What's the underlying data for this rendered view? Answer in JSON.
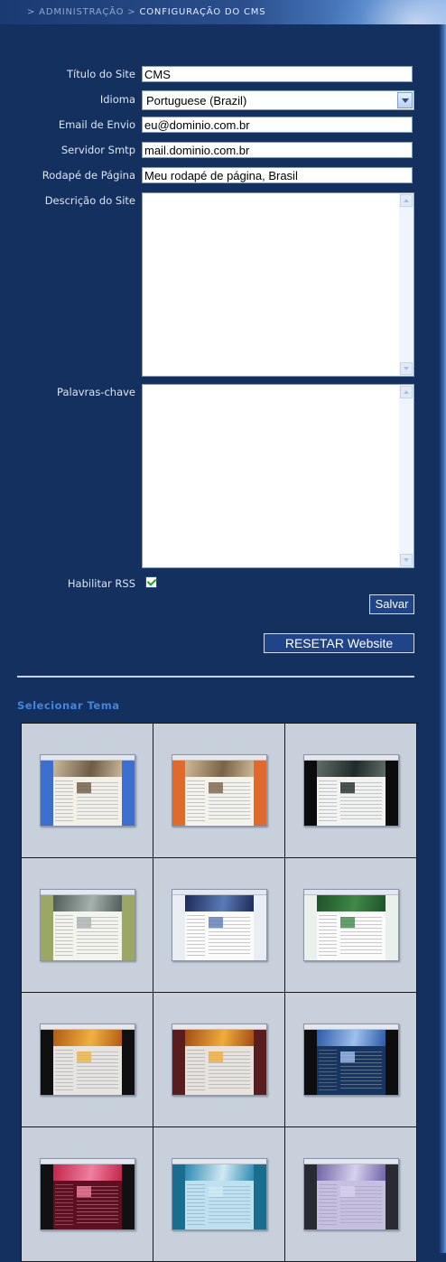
{
  "breadcrumb": {
    "sep": ">",
    "parent": "ADMINISTRAÇÃO",
    "current": "CONFIGURAÇÃO DO CMS"
  },
  "form": {
    "site_title": {
      "label": "Título do Site",
      "value": "CMS"
    },
    "language": {
      "label": "Idioma",
      "value": "Portuguese (Brazil)"
    },
    "email": {
      "label": "Email de Envio",
      "value": "eu@dominio.com.br"
    },
    "smtp": {
      "label": "Servidor Smtp",
      "value": "mail.dominio.com.br"
    },
    "footer": {
      "label": "Rodapé de Página",
      "value": "Meu rodapé de página, Brasil"
    },
    "description": {
      "label": "Descrição do Site",
      "value": ""
    },
    "keywords": {
      "label": "Palavras-chave",
      "value": ""
    },
    "rss": {
      "label": "Habilitar RSS",
      "checked": true
    }
  },
  "buttons": {
    "save": "Salvar",
    "reset": "RESETAR Website"
  },
  "themes": {
    "title": "Selecionar Tema",
    "items": [
      {
        "name": "theme-blue",
        "left": "#3d6fd0",
        "right": "#3d6fd0",
        "page": "#f3f0e6",
        "banner": "#c9b89a",
        "bannerAccent": "#6d5b44"
      },
      {
        "name": "theme-orange",
        "left": "#e06a2c",
        "right": "#e06a2c",
        "page": "#f4f2e9",
        "banner": "#cdb997",
        "bannerAccent": "#7a6246"
      },
      {
        "name": "theme-black",
        "left": "#0c0c0c",
        "right": "#0c0c0c",
        "page": "#f2f2ef",
        "banner": "#5f6d68",
        "bannerAccent": "#1f2b2a"
      },
      {
        "name": "theme-olive",
        "left": "#9ba765",
        "right": "#9ba765",
        "page": "#f4f4ee",
        "banner": "#4e5b57",
        "bannerAccent": "#a6b2ae"
      },
      {
        "name": "theme-navy",
        "left": "#e8eef3",
        "right": "#e8eef3",
        "page": "#fbfbfb",
        "banner": "#1c2a58",
        "bannerAccent": "#5a7bb8"
      },
      {
        "name": "theme-green",
        "left": "#eaf1ec",
        "right": "#eaf1ec",
        "page": "#fbfbfb",
        "banner": "#1f5128",
        "bannerAccent": "#3f8a46"
      },
      {
        "name": "theme-fire",
        "left": "#101010",
        "right": "#101010",
        "page": "#e7e4df",
        "banner": "#b35a12",
        "bannerAccent": "#f0b141"
      },
      {
        "name": "theme-maroon",
        "left": "#5a1d1d",
        "right": "#5a1d1d",
        "page": "#e8e2da",
        "banner": "#a34d14",
        "bannerAccent": "#f0ac3a"
      },
      {
        "name": "theme-night",
        "left": "#0d0d0d",
        "right": "#0d0d0d",
        "page": "#153563",
        "banner": "#2b5ca8",
        "bannerAccent": "#9fc0ee"
      },
      {
        "name": "theme-crimson",
        "left": "#111111",
        "right": "#111111",
        "page": "#5c1020",
        "banner": "#c0264a",
        "bannerAccent": "#f07fa0"
      },
      {
        "name": "theme-teal",
        "left": "#1b6d8f",
        "right": "#1b6d8f",
        "page": "#bfe0ee",
        "banner": "#2a8ab2",
        "bannerAccent": "#d1e9f4"
      },
      {
        "name": "theme-lavender",
        "left": "#2a2a33",
        "right": "#2a2a33",
        "page": "#c7bfe0",
        "banner": "#6f63a6",
        "bannerAccent": "#d7d2ee"
      }
    ]
  }
}
